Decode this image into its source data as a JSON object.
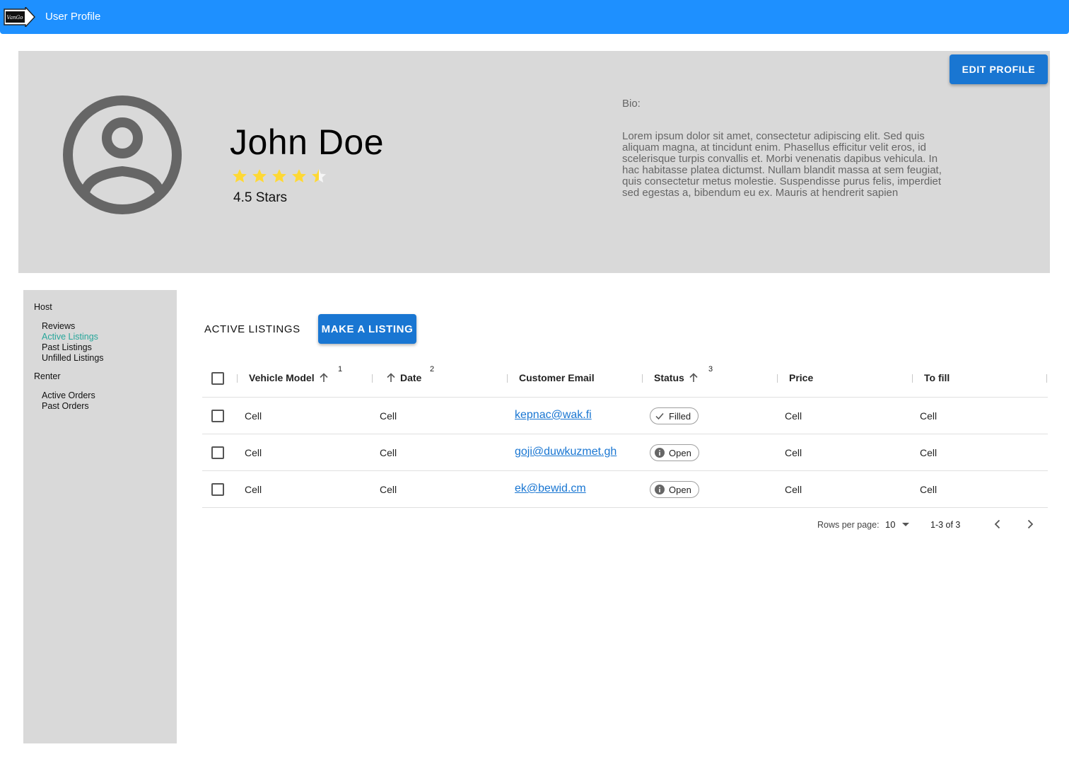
{
  "app": {
    "logo_text": "VanGo",
    "title": "User Profile",
    "brand_color": "#1e90ff"
  },
  "profile": {
    "name": "John Doe",
    "rating": 4.5,
    "rating_label": "4.5 Stars",
    "bio_label": "Bio:",
    "bio_text": "Lorem ipsum dolor sit amet, consectetur adipiscing elit. Sed quis aliquam magna, at tincidunt enim. Phasellus efficitur velit eros, id scelerisque turpis convallis et. Morbi venenatis dapibus vehicula. In hac habitasse platea dictumst. Nullam blandit massa at sem feugiat, quis consectetur metus molestie. Suspendisse purus felis, imperdiet sed egestas a, bibendum eu ex. Mauris at hendrerit sapien",
    "edit_button": "EDIT PROFILE",
    "star_color": "#fdd835"
  },
  "sidebar": {
    "host_label": "Host",
    "host_items": [
      {
        "label": "Reviews",
        "active": false
      },
      {
        "label": "Active Listings",
        "active": true
      },
      {
        "label": "Past Listings",
        "active": false
      },
      {
        "label": "Unfilled Listings",
        "active": false
      }
    ],
    "renter_label": "Renter",
    "renter_items": [
      {
        "label": "Active Orders",
        "active": false
      },
      {
        "label": "Past Orders",
        "active": false
      }
    ],
    "active_color": "#26a69a"
  },
  "listings": {
    "title": "ACTIVE LISTINGS",
    "make_button": "MAKE A LISTING",
    "columns": [
      {
        "label": "Vehicle Model",
        "sort": "asc",
        "sort_order": "1"
      },
      {
        "label": "Date",
        "sort": "asc",
        "sort_order": "2"
      },
      {
        "label": "Customer Email"
      },
      {
        "label": "Status",
        "sort": "asc",
        "sort_order": "3"
      },
      {
        "label": "Price"
      },
      {
        "label": "To fill"
      }
    ],
    "rows": [
      {
        "model": "Cell",
        "date": "Cell",
        "email": " kepnac@wak.fi",
        "status": "Filled",
        "status_icon": "check-icon",
        "price": "Cell",
        "to_fill": "Cell"
      },
      {
        "model": "Cell",
        "date": "Cell",
        "email": "goji@duwkuzmet.gh",
        "status": "Open",
        "status_icon": "info-icon",
        "price": "Cell",
        "to_fill": "Cell"
      },
      {
        "model": "Cell",
        "date": "Cell",
        "email": "ek@bewid.cm",
        "status": "Open",
        "status_icon": "info-icon",
        "price": "Cell",
        "to_fill": "Cell"
      }
    ],
    "pagination": {
      "rows_per_page_label": "Rows per page:",
      "rows_per_page": "10",
      "range": "1-3 of 3"
    }
  }
}
